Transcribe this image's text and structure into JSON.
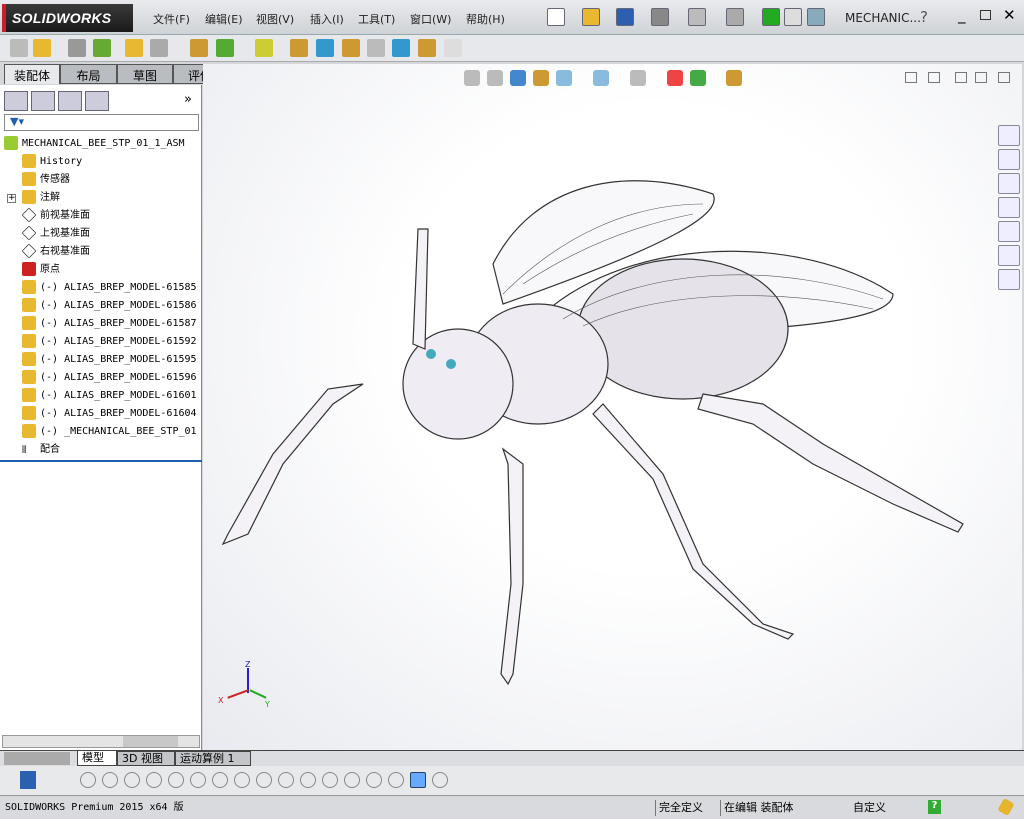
{
  "app": {
    "logo": "SOLIDWORKS",
    "doc_title": "MECHANIC..."
  },
  "menu": [
    "文件(F)",
    "编辑(E)",
    "视图(V)",
    "插入(I)",
    "工具(T)",
    "窗口(W)",
    "帮助(H)"
  ],
  "command_tabs": [
    "装配体",
    "布局",
    "草图",
    "评估"
  ],
  "feature_tree": {
    "root": "MECHANICAL_BEE_STP_01_1_ASM",
    "items": [
      "History",
      "传感器",
      "注解",
      "前视基准面",
      "上视基准面",
      "右视基准面",
      "原点",
      "(-) ALIAS_BREP_MODEL-61585",
      "(-) ALIAS_BREP_MODEL-61586",
      "(-) ALIAS_BREP_MODEL-61587",
      "(-) ALIAS_BREP_MODEL-61592",
      "(-) ALIAS_BREP_MODEL-61595",
      "(-) ALIAS_BREP_MODEL-61596",
      "(-) ALIAS_BREP_MODEL-61601",
      "(-) ALIAS_BREP_MODEL-61604",
      "(-) _MECHANICAL_BEE_STP_01",
      "配合"
    ],
    "expand_symbol": "+",
    "more": "»"
  },
  "bottom_tabs": [
    "模型",
    "3D 视图",
    "运动算例 1"
  ],
  "triad": {
    "z": "Z",
    "x": "X",
    "y": "Y"
  },
  "status": {
    "version": "SOLIDWORKS Premium 2015 x64 版",
    "defined": "完全定义",
    "editing": "在编辑 装配体",
    "custom": "自定义",
    "help": "?"
  },
  "colors": {
    "logo_red": "#c8202a",
    "accent": "#1e5fb4"
  }
}
